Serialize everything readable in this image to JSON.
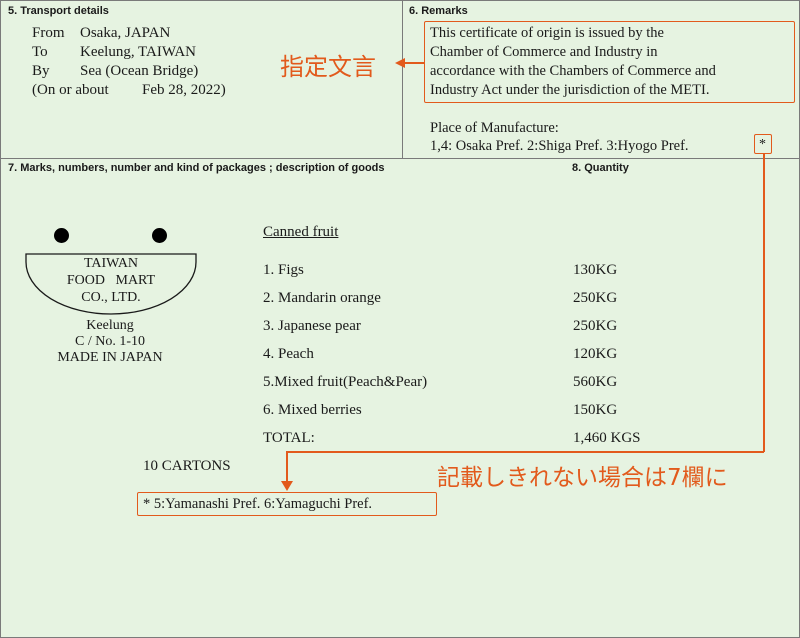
{
  "transport": {
    "header": "5. Transport details",
    "from_label": "From",
    "from_value": "Osaka, JAPAN",
    "to_label": "To",
    "to_value": "Keelung, TAIWAN",
    "by_label": "By",
    "by_value": "Sea (Ocean Bridge)",
    "date_prefix": "(On or about",
    "date_value": "Feb 28, 2022)"
  },
  "annotation_designated": "指定文言",
  "remarks": {
    "header": "6. Remarks",
    "statement_lines": [
      "This certificate of origin is issued by the",
      "Chamber of Commerce and Industry in",
      "accordance with the Chambers of Commerce and",
      "Industry Act under the jurisdiction of the METI."
    ],
    "place_label": "Place of Manufacture:",
    "place_value": "1,4: Osaka Pref. 2:Shiga Pref.  3:Hyogo Pref.",
    "asterisk": "*"
  },
  "goods": {
    "header": "7. Marks, numbers, number and kind of packages ; description of goods",
    "quantity_header": "8. Quantity",
    "mark_lines": [
      "TAIWAN",
      "FOOD   MART",
      "CO., LTD."
    ],
    "mark_below": [
      "Keelung",
      "C / No. 1-10",
      "MADE IN JAPAN"
    ],
    "title": "Canned fruit",
    "items": [
      {
        "name": "1. Figs",
        "qty": "130KG"
      },
      {
        "name": "2. Mandarin orange",
        "qty": "250KG"
      },
      {
        "name": "3. Japanese pear",
        "qty": "250KG"
      },
      {
        "name": "4. Peach",
        "qty": "120KG"
      },
      {
        "name": "5.Mixed fruit(Peach&Pear)",
        "qty": "560KG"
      },
      {
        "name": "6. Mixed berries",
        "qty": "150KG"
      }
    ],
    "total_label": "TOTAL:",
    "total_value": "1,460 KGS",
    "cartons": "10 CARTONS",
    "footnote": "*  5:Yamanashi Pref. 6:Yamaguchi Pref."
  },
  "annotation_overflow": "記載しきれない場合は7欄に",
  "colors": {
    "background": "#e6f3e1",
    "accent": "#e25a1c",
    "border": "#7a7a7a"
  }
}
